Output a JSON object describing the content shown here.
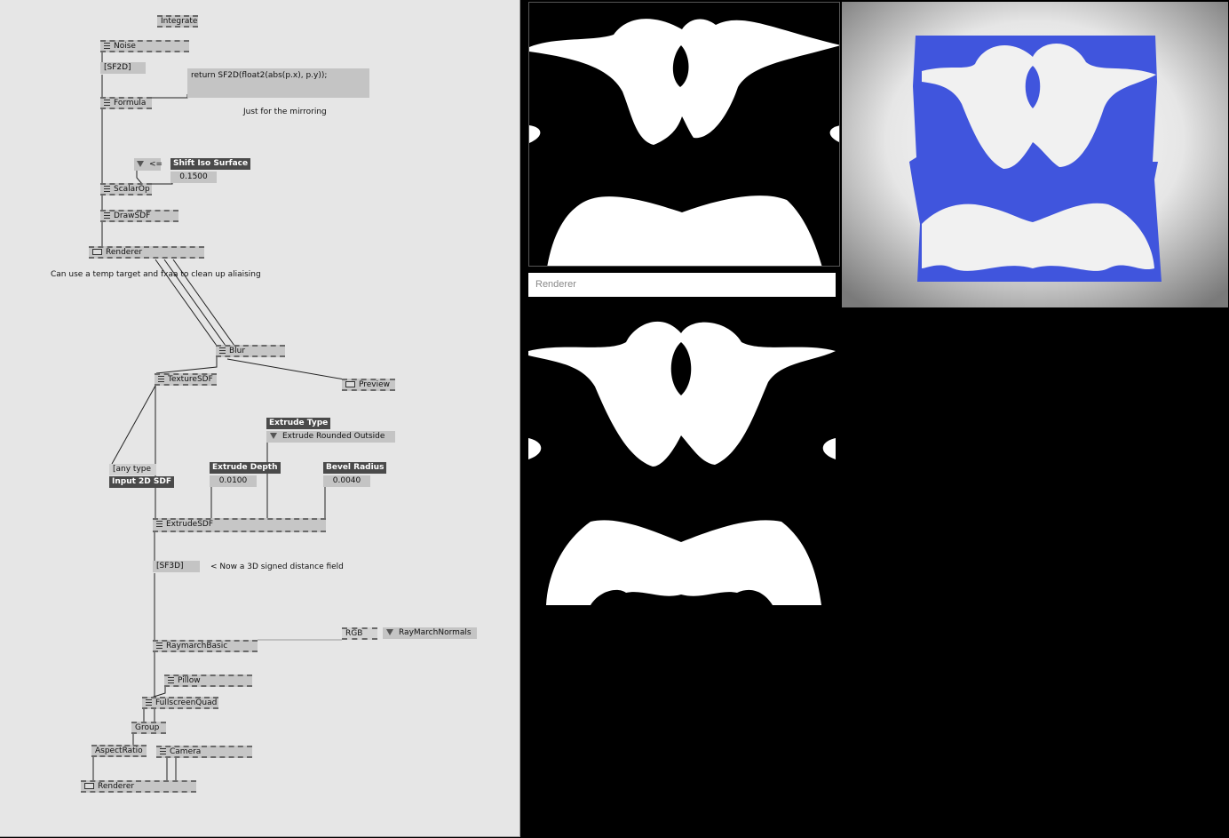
{
  "patch": {
    "nodes": {
      "integrate": "Integrate",
      "noise": "Noise",
      "sf2d": "[SF2D]",
      "formula_code": "return SF2D(float2(abs(p.x), p.y));",
      "formula": "Formula",
      "scalarop": "ScalarOp",
      "drawsdf": "DrawSDF",
      "renderer1": "Renderer",
      "blur": "Blur",
      "preview": "Preview",
      "texturesdf": "TextureSDF",
      "any_type": "[any type",
      "extrudesdf": "ExtrudeSDF",
      "sf3d": "[SF3D]",
      "raymarchbasic": "RaymarchBasic",
      "rgb": "RGB",
      "raymarchnormals": "RayMarchNormals",
      "pillow": "Pillow",
      "fullscreenquad": "FullscreenQuad",
      "group": "Group",
      "aspectratio": "AspectRatio",
      "camera": "Camera",
      "renderer2": "Renderer"
    },
    "comparator": "<=",
    "params": {
      "shift_iso_label": "Shift Iso Surface",
      "shift_iso_value": "0.1500",
      "extrude_type_label": "Extrude Type",
      "extrude_type_value": "Extrude Rounded Outside",
      "input_2d_sdf_label": "Input 2D SDF",
      "extrude_depth_label": "Extrude Depth",
      "extrude_depth_value": "0.0100",
      "bevel_radius_label": "Bevel Radius",
      "bevel_radius_value": "0.0040"
    },
    "comments": {
      "mirroring": "Just for the mirroring",
      "temp_target": "Can use a temp target and fxaa to clean up aliaising",
      "sf3d_note": "< Now a 3D signed distance field"
    }
  },
  "renderer_window": {
    "title": "Renderer"
  },
  "colors": {
    "patch_bg": "#e6e6e6",
    "node_fill": "#c6c6c6",
    "label_bg": "#4a4a4a",
    "render_blue": "#4055dd",
    "render_white": "#ffffff"
  }
}
